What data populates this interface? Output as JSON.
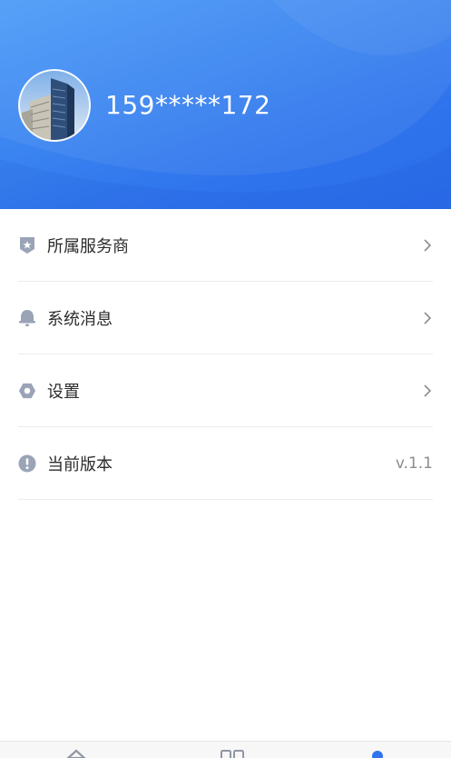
{
  "profile": {
    "phone": "159*****172"
  },
  "menu": {
    "items": [
      {
        "label": "所属服务商",
        "icon": "shield-star-icon",
        "arrow": "chevron-right-icon"
      },
      {
        "label": "系统消息",
        "icon": "bell-icon",
        "arrow": "chevron-right-icon"
      },
      {
        "label": "设置",
        "icon": "hexagon-settings-icon",
        "arrow": "chevron-right-icon"
      },
      {
        "label": "当前版本",
        "icon": "exclamation-circle-icon",
        "value": "v.1.1"
      }
    ]
  },
  "tabbar": {
    "tabs": [
      {
        "icon": "home-icon",
        "active": false
      },
      {
        "icon": "grid-icon",
        "active": false
      },
      {
        "icon": "user-icon",
        "active": true
      }
    ]
  },
  "colors": {
    "header_start": "#4d9cf8",
    "header_end": "#2a6ce9",
    "icon_gray": "#9aa4b6",
    "active_blue": "#2f74ec"
  }
}
